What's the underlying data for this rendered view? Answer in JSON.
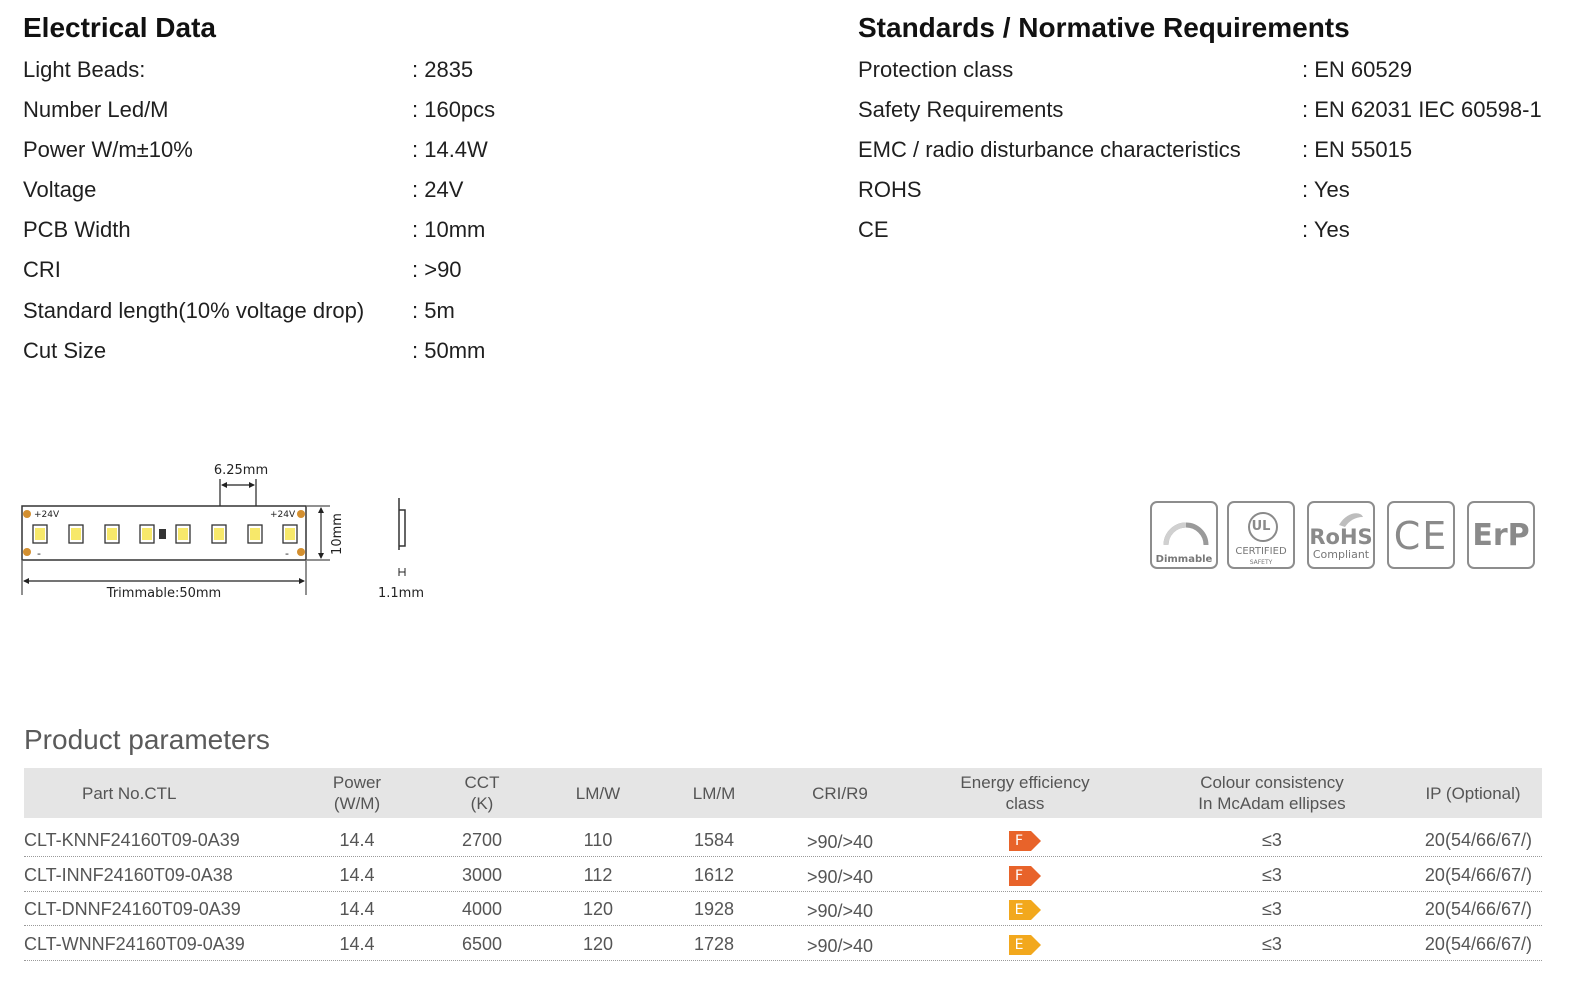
{
  "electrical": {
    "title": "Electrical Data",
    "rows": [
      {
        "label": "Light Beads:",
        "value": ": 2835"
      },
      {
        "label": "Number Led/M",
        "value": ": 160pcs"
      },
      {
        "label": "Power W/m±10%",
        "value": ": 14.4W"
      },
      {
        "label": "Voltage",
        "value": ": 24V"
      },
      {
        "label": "PCB Width",
        "value": ": 10mm"
      },
      {
        "label": "CRI",
        "value": ": >90"
      },
      {
        "label": "Standard length(10% voltage drop)",
        "value": ": 5m"
      },
      {
        "label": "Cut Size",
        "value": ": 50mm"
      }
    ]
  },
  "standards": {
    "title": "Standards / Normative Requirements",
    "rows": [
      {
        "label": "Protection class",
        "value": ": EN 60529"
      },
      {
        "label": "Safety Requirements",
        "value": ": EN 62031 IEC 60598-1"
      },
      {
        "label": "EMC / radio disturbance characteristics",
        "value": ": EN 55015"
      },
      {
        "label": "ROHS",
        "value": ": Yes"
      },
      {
        "label": "CE",
        "value": ": Yes"
      }
    ]
  },
  "diagram": {
    "pitch_label": "6.25mm",
    "plus_left": "+24V",
    "plus_right": "+24V",
    "minus": "-",
    "width_label": "10mm",
    "trim_label": "Trimmable:50mm",
    "thickness_label": "1.1mm"
  },
  "badges": {
    "dimmable": "Dimmable",
    "ul_mark": "UL",
    "ul_certified": "CERTIFIED",
    "ul_safety": "SAFETY",
    "rohs": "RoHS",
    "rohs_compliant": "Compliant",
    "ce": "CE",
    "erp": "ErP"
  },
  "product": {
    "title": "Product parameters",
    "headers": {
      "part": "Part No.CTL",
      "power_1": "Power",
      "power_2": "(W/M)",
      "cct_1": "CCT",
      "cct_2": "(K)",
      "lmw": "LM/W",
      "lmm": "LM/M",
      "cri": "CRI/R9",
      "energy_1": "Energy efficiency",
      "energy_2": "class",
      "colour_1": "Colour consistency",
      "colour_2": "In McAdam ellipses",
      "ip": "IP (Optional)"
    },
    "rows": [
      {
        "part": "CLT-KNNF24160T09-0A39",
        "power": "14.4",
        "cct": "2700",
        "lmw": "110",
        "lmm": "1584",
        "cri": ">90/>40",
        "energy": "F",
        "energy_color": "#e8632a",
        "colour": "≤3",
        "ip": "20(54/66/67/)"
      },
      {
        "part": "CLT-INNF24160T09-0A38",
        "power": "14.4",
        "cct": "3000",
        "lmw": "112",
        "lmm": "1612",
        "cri": ">90/>40",
        "energy": "F",
        "energy_color": "#e8632a",
        "colour": "≤3",
        "ip": "20(54/66/67/)"
      },
      {
        "part": "CLT-DNNF24160T09-0A39",
        "power": "14.4",
        "cct": "4000",
        "lmw": "120",
        "lmm": "1928",
        "cri": ">90/>40",
        "energy": "E",
        "energy_color": "#f2a81d",
        "colour": "≤3",
        "ip": "20(54/66/67/)"
      },
      {
        "part": "CLT-WNNF24160T09-0A39",
        "power": "14.4",
        "cct": "6500",
        "lmw": "120",
        "lmm": "1728",
        "cri": ">90/>40",
        "energy": "E",
        "energy_color": "#f2a81d",
        "colour": "≤3",
        "ip": "20(54/66/67/)"
      }
    ]
  }
}
